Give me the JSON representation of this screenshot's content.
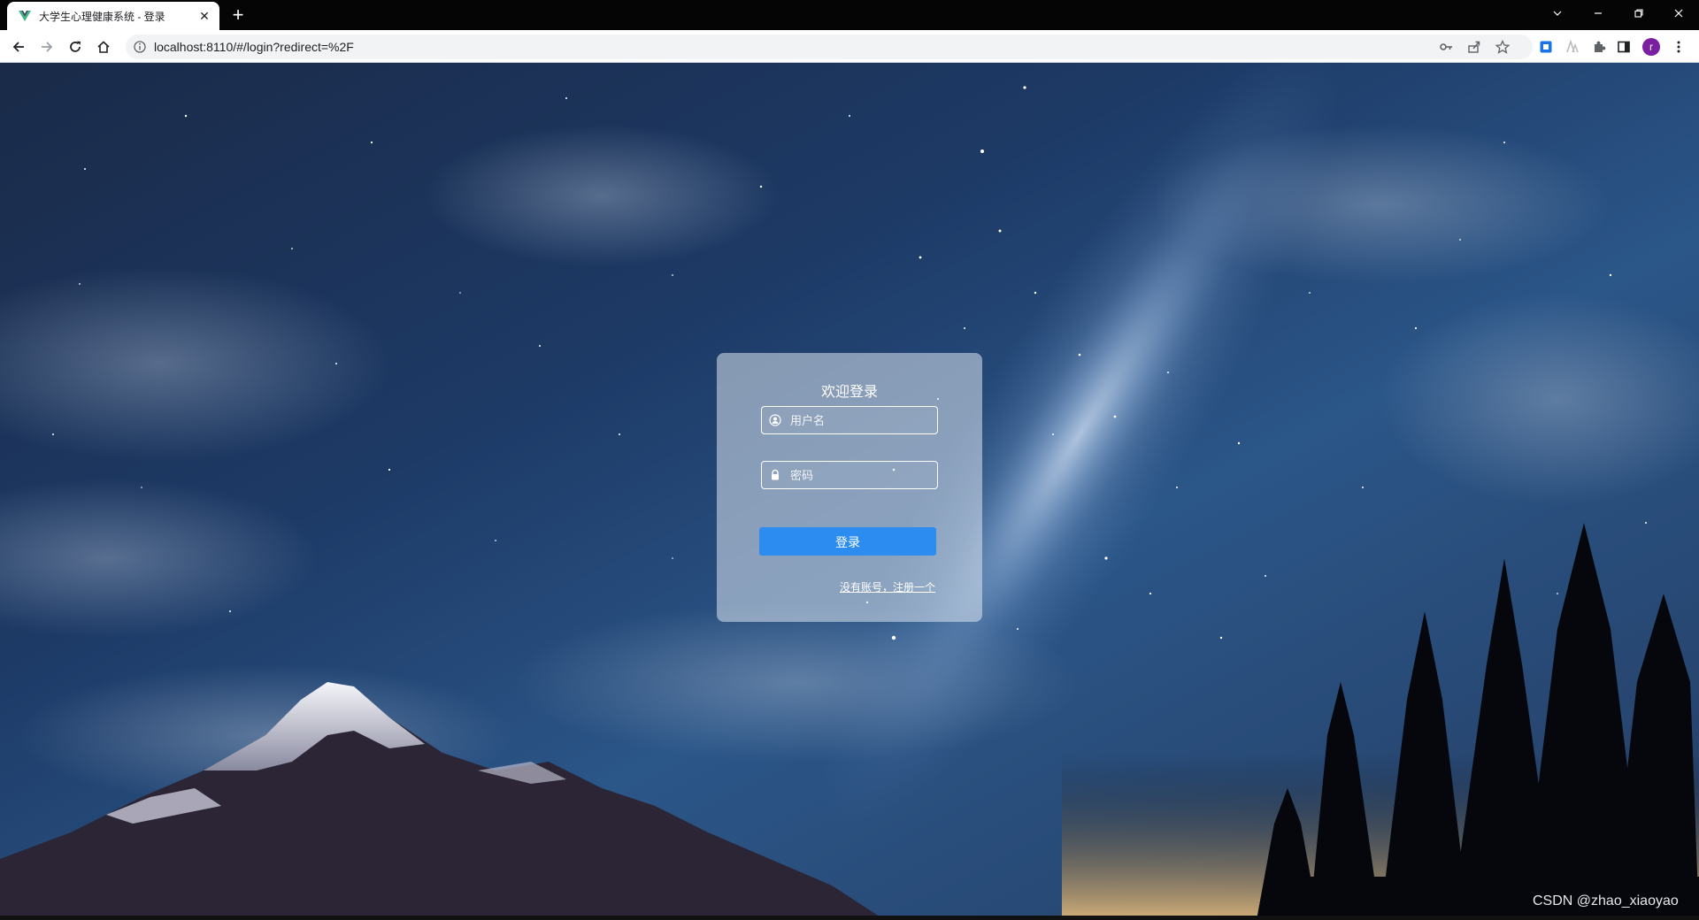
{
  "browser": {
    "tab": {
      "title": "大学生心理健康系统 - 登录",
      "close_glyph": "✕",
      "favicon": "vue-icon"
    },
    "new_tab_glyph": "+",
    "url": "localhost:8110/#/login?redirect=%2F",
    "avatar_letter": "r",
    "icons": [
      "back-arrow-icon",
      "forward-arrow-icon",
      "reload-icon",
      "home-icon",
      "site-info-icon",
      "key-icon",
      "share-icon",
      "star-icon",
      "extension-icon",
      "puzzle-icon",
      "sidebar-icon",
      "kebab-menu-icon"
    ]
  },
  "login": {
    "title": "欢迎登录",
    "username_placeholder": "用户名",
    "password_placeholder": "密码",
    "login_button": "登录",
    "register_link": "没有账号，注册一个"
  },
  "watermark": "CSDN @zhao_xiaoyao",
  "colors": {
    "accent": "#2d8cf0",
    "avatar": "#7b1fa2",
    "sky_top": "#15243f",
    "sky_mid": "#2e5a8e"
  }
}
